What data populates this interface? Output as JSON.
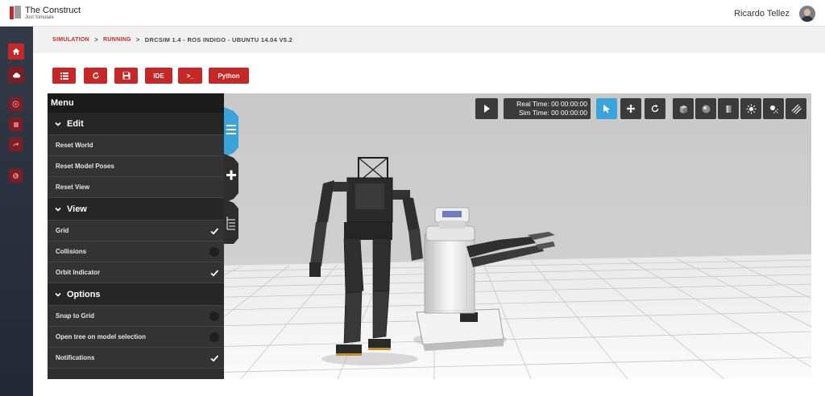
{
  "header": {
    "brand_title": "The Construct",
    "brand_subtitle": "Just Simulate",
    "user_name": "Ricardo Tellez"
  },
  "sidebar": {
    "items": [
      {
        "icon": "home-icon"
      },
      {
        "icon": "cloud-icon"
      },
      {
        "icon": "target-icon"
      },
      {
        "icon": "stop-icon"
      },
      {
        "icon": "share-icon"
      },
      {
        "icon": "globe-icon"
      }
    ]
  },
  "breadcrumb": {
    "items": [
      "SIMULATION",
      "RUNNING"
    ],
    "current": "DRCSIM 1.4 - ROS INDIGO - UBUNTU 14.04 V5.2",
    "separator": ">"
  },
  "toolbar": {
    "list_icon": "list-icon",
    "refresh_icon": "refresh-icon",
    "save_icon": "save-icon",
    "ide_label": "IDE",
    "terminal_label": ">_",
    "python_label": "Python"
  },
  "menu": {
    "title": "Menu",
    "sections": [
      {
        "label": "Edit",
        "items": [
          {
            "label": "Reset World"
          },
          {
            "label": "Reset Model Poses"
          },
          {
            "label": "Reset View"
          }
        ]
      },
      {
        "label": "View",
        "items": [
          {
            "label": "Grid",
            "checked": true
          },
          {
            "label": "Collisions",
            "checked": false
          },
          {
            "label": "Orbit Indicator",
            "checked": true
          }
        ]
      },
      {
        "label": "Options",
        "items": [
          {
            "label": "Snap to Grid",
            "checked": false
          },
          {
            "label": "Open tree on model selection",
            "checked": false
          },
          {
            "label": "Notifications",
            "checked": true
          }
        ]
      }
    ]
  },
  "simulation": {
    "real_time": "Real Time: 00 00:00:00",
    "sim_time": "Sim Time: 00 00:00:00"
  },
  "colors": {
    "accent": "#c62828",
    "active_tool": "#3aa3da",
    "menu_bg": "#2d2d2d"
  }
}
